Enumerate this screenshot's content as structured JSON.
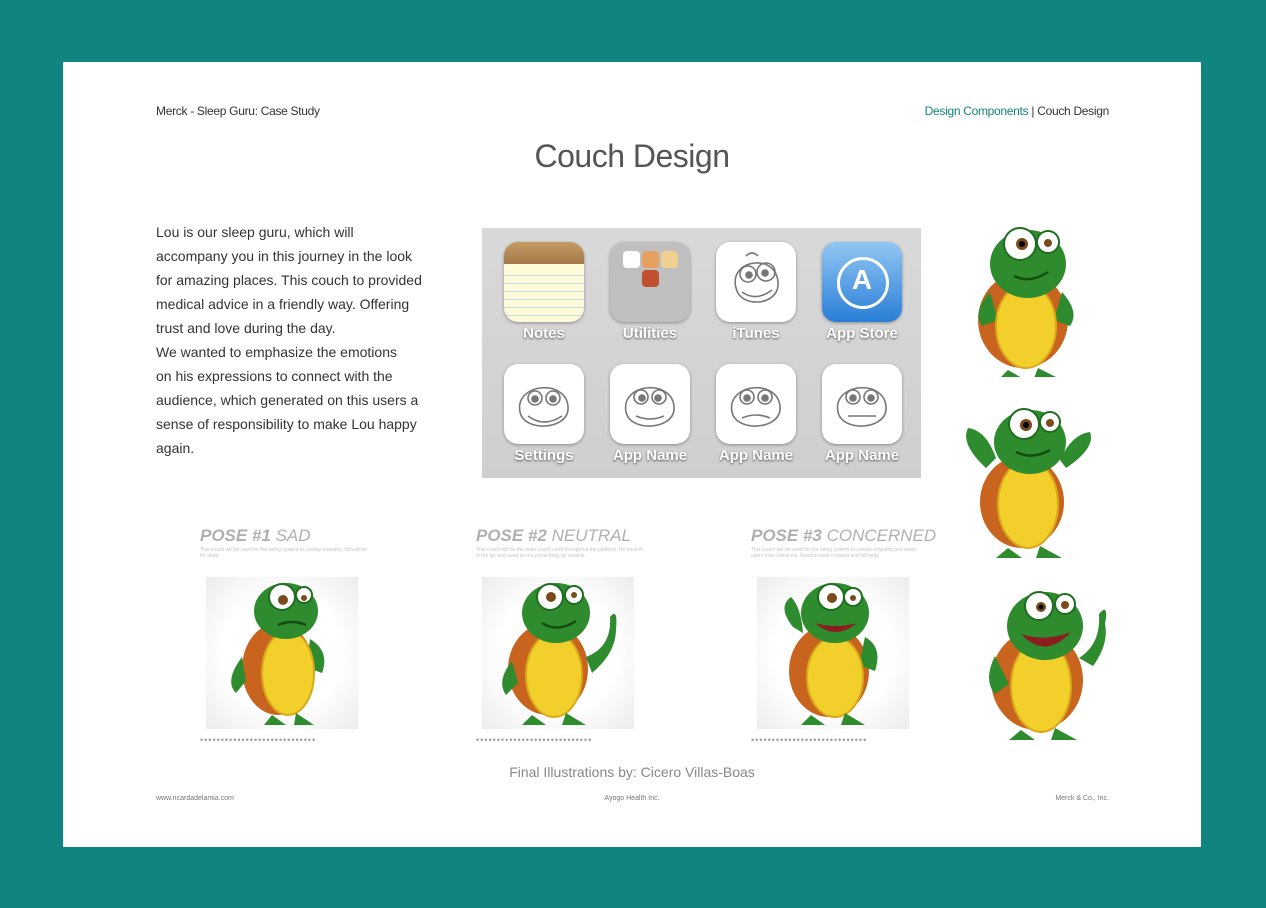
{
  "header": {
    "left": "Merck - Sleep Guru: Case Study",
    "right_link": "Design Components",
    "separator": "|",
    "right_current": "Couch Design"
  },
  "title": "Couch Design",
  "intro": {
    "lines": [
      "Lou is our sleep guru, which will",
      "accompany you in this journey in the look",
      "for amazing places. This couch to provided",
      "medical advice in a friendly way. Offering",
      "trust and love during the day.",
      "We wanted to emphasize the emotions",
      "on his expressions to connect with the",
      "audience, which generated on this users a",
      "sense of responsibility to make Lou happy",
      "again."
    ]
  },
  "phone": {
    "apps": [
      "Notes",
      "Utilities",
      "iTunes",
      "App Store",
      "Settings",
      "App Name",
      "App Name",
      "App Name"
    ]
  },
  "poses": [
    {
      "num": "POSE #1",
      "mood": " SAD",
      "desc": "This coach will be used for the rating system to convey empathy. Should be for study"
    },
    {
      "num": "POSE #2",
      "mood": " NEUTRAL",
      "desc": "This coach will be the main coach used throughout the platform. He must fit in the tip, and used as our portal body for models."
    },
    {
      "num": "POSE #3",
      "mood": " CONCERNED",
      "desc": "This coach will be used for the rating system to convey empathy and when users miss check-ins. Need to work cropped and full body."
    }
  ],
  "dots": "••••••••••••••••••••••••••••",
  "credit": "Final Illustrations by: Cicero Villas-Boas",
  "footer": {
    "left": "www.ricardadelamia.com",
    "center": "Ayogo Health Inc.",
    "right": "Merck & Co., Inc."
  },
  "colors": {
    "background": "#10847e",
    "accent": "#10847e",
    "turtle_green": "#2e8b2e",
    "shell_yellow": "#f2cf2a",
    "shell_orange": "#c8641e"
  }
}
